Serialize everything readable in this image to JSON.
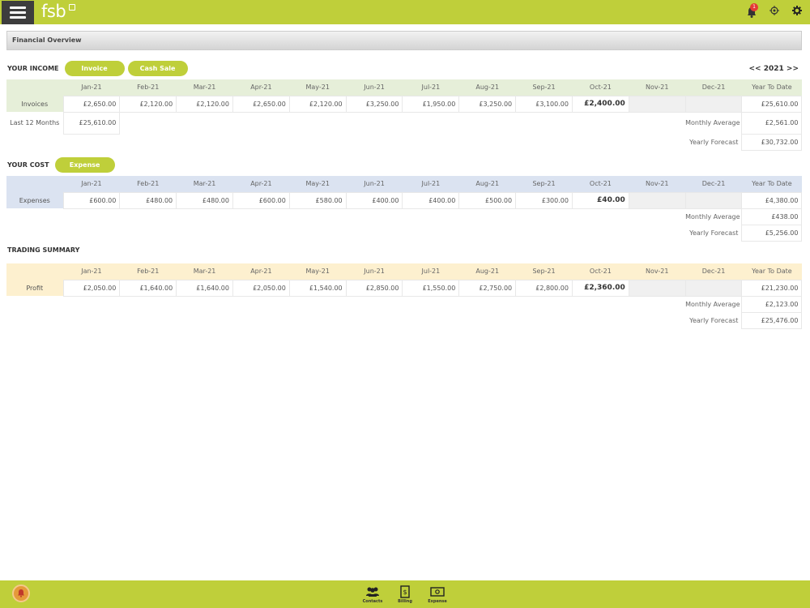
{
  "header": {
    "logo": "fsb",
    "notification_count": "1"
  },
  "breadcrumb": "Financial Overview",
  "year_nav": "<< 2021 >>",
  "months": [
    "Jan-21",
    "Feb-21",
    "Mar-21",
    "Apr-21",
    "May-21",
    "Jun-21",
    "Jul-21",
    "Aug-21",
    "Sep-21",
    "Oct-21",
    "Nov-21",
    "Dec-21"
  ],
  "ytd_label": "Year To Date",
  "income": {
    "title": "YOUR INCOME",
    "buttons": [
      "Invoice",
      "Cash Sale"
    ],
    "row_label": "Invoices",
    "values": [
      "£2,650.00",
      "£2,120.00",
      "£2,120.00",
      "£2,650.00",
      "£2,120.00",
      "£3,250.00",
      "£1,950.00",
      "£3,250.00",
      "£3,100.00",
      "£2,400.00",
      "",
      ""
    ],
    "ytd": "£25,610.00",
    "last12_label": "Last 12 Months",
    "last12_value": "£25,610.00",
    "monthly_average_label": "Monthly Average",
    "monthly_average": "£2,561.00",
    "yearly_forecast_label": "Yearly Forecast",
    "yearly_forecast": "£30,732.00"
  },
  "cost": {
    "title": "YOUR COST",
    "buttons": [
      "Expense"
    ],
    "row_label": "Expenses",
    "values": [
      "£600.00",
      "£480.00",
      "£480.00",
      "£600.00",
      "£580.00",
      "£400.00",
      "£400.00",
      "£500.00",
      "£300.00",
      "£40.00",
      "",
      ""
    ],
    "ytd": "£4,380.00",
    "monthly_average_label": "Monthly Average",
    "monthly_average": "£438.00",
    "yearly_forecast_label": "Yearly Forecast",
    "yearly_forecast": "£5,256.00"
  },
  "trading": {
    "title": "TRADING SUMMARY",
    "row_label": "Profit",
    "values": [
      "£2,050.00",
      "£1,640.00",
      "£1,640.00",
      "£2,050.00",
      "£1,540.00",
      "£2,850.00",
      "£1,550.00",
      "£2,750.00",
      "£2,800.00",
      "£2,360.00",
      "",
      ""
    ],
    "ytd": "£21,230.00",
    "monthly_average_label": "Monthly Average",
    "monthly_average": "£2,123.00",
    "yearly_forecast_label": "Yearly Forecast",
    "yearly_forecast": "£25,476.00"
  },
  "footer": {
    "nav": [
      "Contacts",
      "Billing",
      "Expense"
    ]
  }
}
